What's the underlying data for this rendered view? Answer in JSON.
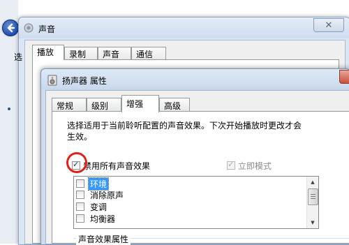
{
  "sound_window": {
    "title": "声音",
    "tabs": [
      {
        "label": "播放",
        "active": true
      },
      {
        "label": "录制",
        "active": false
      },
      {
        "label": "声音",
        "active": false
      },
      {
        "label": "通信",
        "active": false
      }
    ],
    "partial_text": "选"
  },
  "speaker_dialog": {
    "title": "扬声器 属性",
    "tabs": [
      {
        "label": "常规",
        "active": false
      },
      {
        "label": "级别",
        "active": false
      },
      {
        "label": "增强",
        "active": true
      },
      {
        "label": "高级",
        "active": false
      }
    ],
    "description": "选择适用于当前聆听配置的声音效果。下次开始播放时更改才会生效。",
    "disable_all": {
      "label": "禁用所有声音效果",
      "checked": true
    },
    "immediate_mode": {
      "label": "立即模式",
      "checked": true,
      "enabled": false
    },
    "effects": [
      {
        "label": "环境",
        "checked": false,
        "selected": true
      },
      {
        "label": "消除原声",
        "checked": false,
        "selected": false
      },
      {
        "label": "变调",
        "checked": false,
        "selected": false
      },
      {
        "label": "均衡器",
        "checked": false,
        "selected": false
      }
    ],
    "group_label": "声音效果属性"
  },
  "colors": {
    "highlight": "#3399ff",
    "annotation_circle": "#e0201b"
  }
}
